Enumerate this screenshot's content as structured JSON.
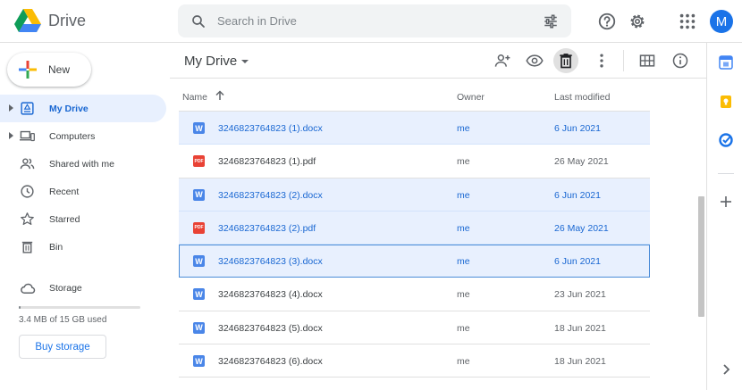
{
  "app": {
    "name": "Drive"
  },
  "search": {
    "placeholder": "Search in Drive"
  },
  "user": {
    "avatar_letter": "M"
  },
  "sidebar": {
    "new_label": "New",
    "items": [
      {
        "label": "My Drive",
        "icon": "my-drive-icon",
        "active": true,
        "expandable": true
      },
      {
        "label": "Computers",
        "icon": "computers-icon",
        "active": false,
        "expandable": true
      },
      {
        "label": "Shared with me",
        "icon": "shared-icon",
        "active": false,
        "expandable": false
      },
      {
        "label": "Recent",
        "icon": "clock-icon",
        "active": false,
        "expandable": false
      },
      {
        "label": "Starred",
        "icon": "star-icon",
        "active": false,
        "expandable": false
      },
      {
        "label": "Bin",
        "icon": "bin-icon",
        "active": false,
        "expandable": false
      }
    ],
    "storage_label": "Storage",
    "storage_used_text": "3.4 MB of 15 GB used",
    "storage_fraction": 0.0002,
    "buy_storage_label": "Buy storage"
  },
  "main": {
    "breadcrumb": "My Drive",
    "columns": {
      "name": "Name",
      "owner": "Owner",
      "modified": "Last modified"
    },
    "files": [
      {
        "name": "3246823764823 (1).docx",
        "type": "docx",
        "owner": "me",
        "modified": "6 Jun 2021",
        "selected": true,
        "focused": false
      },
      {
        "name": "3246823764823 (1).pdf",
        "type": "pdf",
        "owner": "me",
        "modified": "26 May 2021",
        "selected": false,
        "focused": false
      },
      {
        "name": "3246823764823 (2).docx",
        "type": "docx",
        "owner": "me",
        "modified": "6 Jun 2021",
        "selected": true,
        "focused": false
      },
      {
        "name": "3246823764823 (2).pdf",
        "type": "pdf",
        "owner": "me",
        "modified": "26 May 2021",
        "selected": true,
        "focused": false
      },
      {
        "name": "3246823764823 (3).docx",
        "type": "docx",
        "owner": "me",
        "modified": "6 Jun 2021",
        "selected": true,
        "focused": true
      },
      {
        "name": "3246823764823 (4).docx",
        "type": "docx",
        "owner": "me",
        "modified": "23 Jun 2021",
        "selected": false,
        "focused": false
      },
      {
        "name": "3246823764823 (5).docx",
        "type": "docx",
        "owner": "me",
        "modified": "18 Jun 2021",
        "selected": false,
        "focused": false
      },
      {
        "name": "3246823764823 (6).docx",
        "type": "docx",
        "owner": "me",
        "modified": "18 Jun 2021",
        "selected": false,
        "focused": false
      }
    ],
    "file_badges": {
      "docx": "W",
      "pdf": "PDF"
    }
  },
  "colors": {
    "accent": "#1a73e8",
    "selected_bg": "#e8f0fe",
    "selected_text": "#1967d2",
    "docx": "#4a86e8",
    "pdf": "#e94235"
  }
}
